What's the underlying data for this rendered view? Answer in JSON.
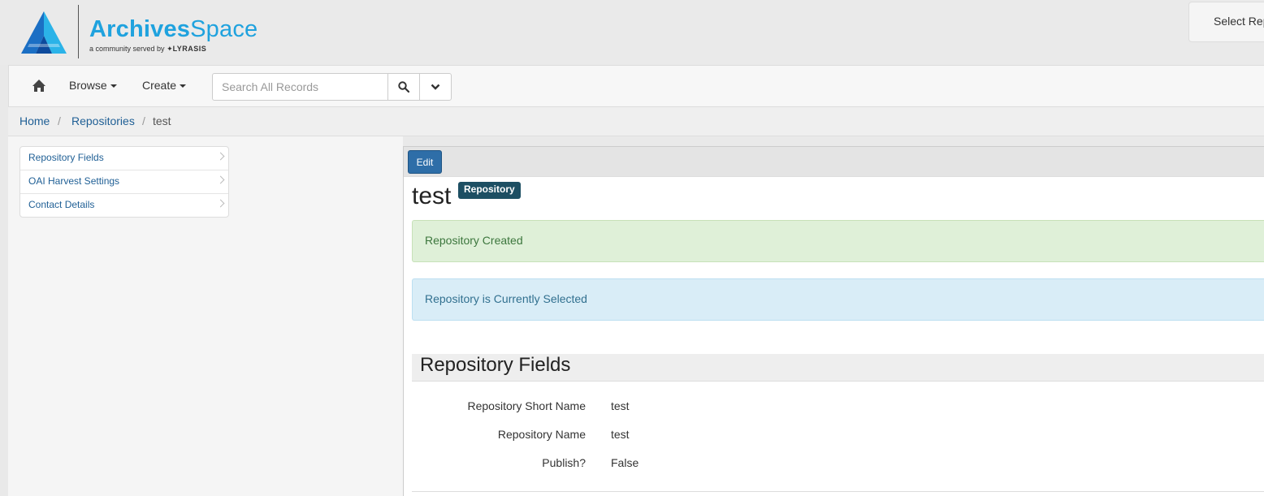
{
  "header": {
    "logo_word_bold": "Archives",
    "logo_word_light": "Space",
    "logo_tagline": "a community served by",
    "logo_partner": "LYRASIS",
    "repo_select_label": "Select Repository",
    "brand_color": "#1fa2de"
  },
  "nav": {
    "home_icon": "home-icon",
    "browse_label": "Browse",
    "create_label": "Create",
    "search_placeholder": "Search All Records",
    "search_icon": "search-icon",
    "advanced_icon": "chevron-down-icon"
  },
  "breadcrumb": {
    "items": [
      "Home",
      "Repositories",
      "test"
    ],
    "separator": "/"
  },
  "sidebar": {
    "items": [
      {
        "label": "Repository Fields"
      },
      {
        "label": "OAI Harvest Settings"
      },
      {
        "label": "Contact Details"
      }
    ]
  },
  "record": {
    "edit_label": "Edit",
    "title": "test",
    "badge": "Repository",
    "alert_success": "Repository Created",
    "alert_info": "Repository is Currently Selected",
    "section_title": "Repository Fields",
    "fields": [
      {
        "label": "Repository Short Name",
        "value": "test"
      },
      {
        "label": "Repository Name",
        "value": "test"
      },
      {
        "label": "Publish?",
        "value": "False"
      }
    ]
  }
}
